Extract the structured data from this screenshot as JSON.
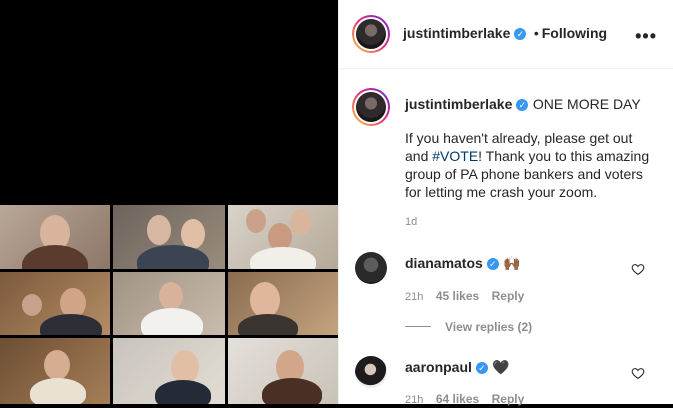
{
  "post": {
    "author": "justintimberlake",
    "follow_state": "Following",
    "more_icon": "•••"
  },
  "caption": {
    "author": "justintimberlake",
    "title": "ONE MORE DAY",
    "text_before": "If you haven't already, please get out and ",
    "hashtag": "#VOTE",
    "text_after": "! Thank you to this amazing group of PA phone bankers and voters for letting me crash your zoom.",
    "time": "1d"
  },
  "comments": [
    {
      "author": "dianamatos",
      "emoji": "🙌🏾",
      "time": "21h",
      "likes": "45 likes",
      "reply": "Reply",
      "view_replies": "View replies (2)"
    },
    {
      "author": "aaronpaul",
      "emoji": "🖤",
      "time": "21h",
      "likes": "64 likes",
      "reply": "Reply"
    }
  ],
  "colors": {
    "verified": "#3897f0",
    "text": "#262626",
    "muted": "#8e8e8e",
    "hashtag": "#00376b"
  }
}
